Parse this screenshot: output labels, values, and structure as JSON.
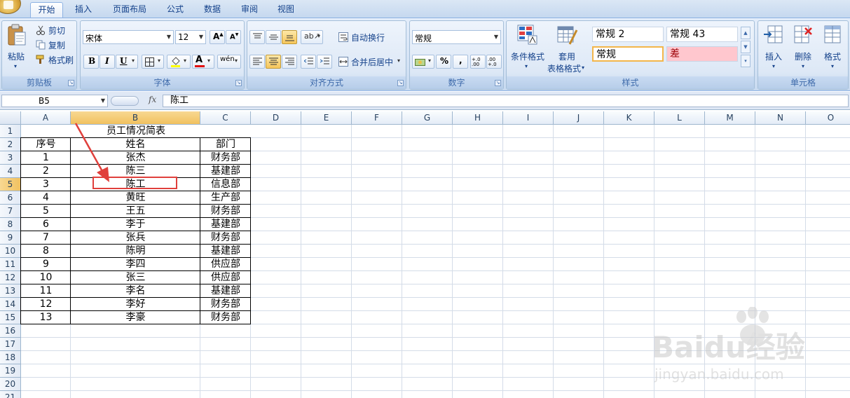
{
  "tabs": [
    {
      "label": "开始",
      "active": true
    },
    {
      "label": "插入"
    },
    {
      "label": "页面布局"
    },
    {
      "label": "公式"
    },
    {
      "label": "数据"
    },
    {
      "label": "审阅"
    },
    {
      "label": "视图"
    }
  ],
  "ribbon": {
    "clipboard": {
      "paste": "粘贴",
      "cut": "剪切",
      "copy": "复制",
      "format_painter": "格式刷",
      "label": "剪贴板"
    },
    "font": {
      "name": "宋体",
      "size": "12",
      "bold": "B",
      "italic": "I",
      "underline": "U",
      "label": "字体"
    },
    "alignment": {
      "wrap": "自动换行",
      "merge": "合并后居中",
      "label": "对齐方式"
    },
    "number": {
      "format": "常规",
      "percent": "%",
      "comma": ",",
      "inc_decimal": "+.0 .00",
      "dec_decimal": ".00 +.0",
      "label": "数字"
    },
    "styles": {
      "cond_format": "条件格式",
      "table_format_1": "套用",
      "table_format_2": "表格格式",
      "style_a": "常规 2",
      "style_b": "常规 43",
      "style_c": "常规",
      "style_d": "差",
      "label": "样式"
    },
    "cells": {
      "insert": "插入",
      "delete": "删除",
      "format": "格式",
      "label": "单元格"
    }
  },
  "formula_bar": {
    "name_box": "B5",
    "fx": "fx",
    "value": "陈工"
  },
  "columns": [
    "A",
    "B",
    "C",
    "D",
    "E",
    "F",
    "G",
    "H",
    "I",
    "J",
    "K",
    "L",
    "M",
    "N",
    "O"
  ],
  "rows": [
    "1",
    "2",
    "3",
    "4",
    "5",
    "6",
    "7",
    "8",
    "9",
    "10",
    "11",
    "12",
    "13",
    "14",
    "15",
    "16",
    "17",
    "18",
    "19",
    "20",
    "21"
  ],
  "sheet": {
    "title": "员工情况简表",
    "headers": [
      "序号",
      "姓名",
      "部门"
    ],
    "records": [
      [
        "1",
        "张杰",
        "财务部"
      ],
      [
        "2",
        "陈三",
        "基建部"
      ],
      [
        "3",
        "陈工",
        "信息部"
      ],
      [
        "4",
        "黄旺",
        "生产部"
      ],
      [
        "5",
        "王五",
        "财务部"
      ],
      [
        "6",
        "李于",
        "基建部"
      ],
      [
        "7",
        "张兵",
        "财务部"
      ],
      [
        "8",
        "陈明",
        "基建部"
      ],
      [
        "9",
        "李四",
        "供应部"
      ],
      [
        "10",
        "张三",
        "供应部"
      ],
      [
        "11",
        "李名",
        "基建部"
      ],
      [
        "12",
        "李好",
        "财务部"
      ],
      [
        "13",
        "李豪",
        "财务部"
      ]
    ]
  },
  "watermark": {
    "brand": "Baidu经验",
    "url": "jingyan.baidu.com"
  },
  "colors": {
    "accent": "#15428b",
    "selection": "#f1c15f",
    "highlight": "#e0403c"
  }
}
